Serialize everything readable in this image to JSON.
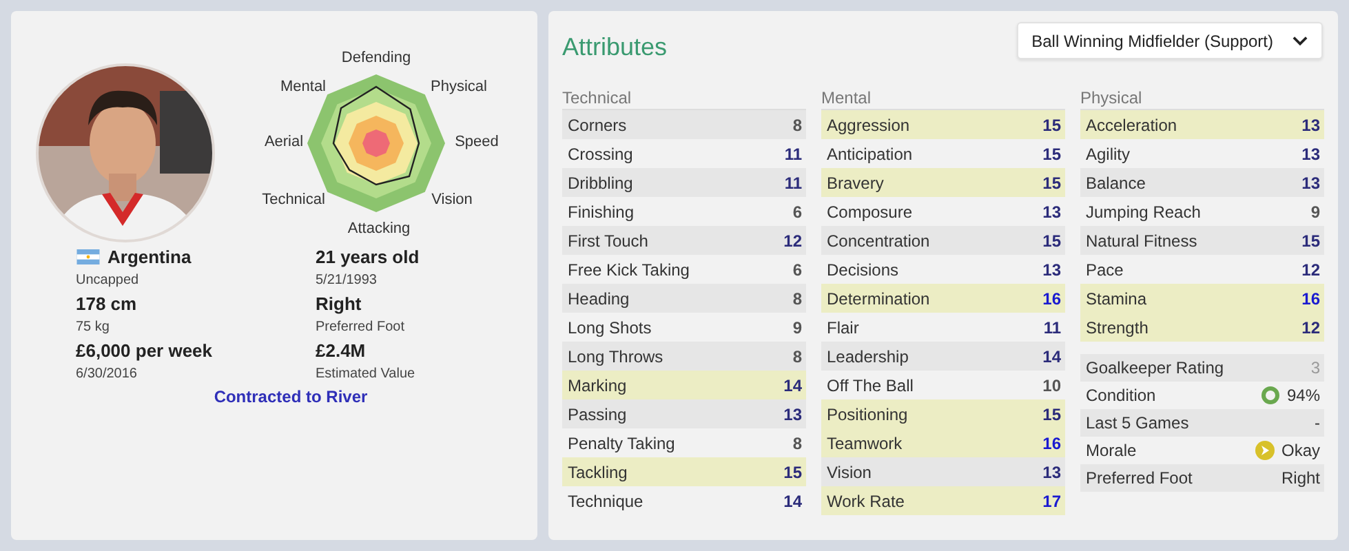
{
  "player": {
    "radar_labels": [
      {
        "text": "Defending"
      },
      {
        "text": "Mental"
      },
      {
        "text": "Physical"
      },
      {
        "text": "Aerial"
      },
      {
        "text": "Speed"
      },
      {
        "text": "Technical"
      },
      {
        "text": "Vision"
      },
      {
        "text": "Attacking"
      }
    ],
    "nationality": "Argentina",
    "caps": "Uncapped",
    "age": "21 years old",
    "birth_date": "5/21/1993",
    "height": "178 cm",
    "weight": "75 kg",
    "foot": "Right",
    "foot_label": "Preferred Foot",
    "wage": "£6,000 per week",
    "contract_end": "6/30/2016",
    "value": "£2.4M",
    "value_label": "Estimated Value",
    "contract_link": "Contracted to River"
  },
  "attributes": {
    "title": "Attributes",
    "role_dropdown": "Ball Winning Midfielder (Support)",
    "groups": [
      {
        "title": "Technical",
        "rows": [
          {
            "name": "Corners",
            "value": "8",
            "highlighted": false,
            "color": "#555555"
          },
          {
            "name": "Crossing",
            "value": "11",
            "highlighted": false,
            "color": "#2b2b7a"
          },
          {
            "name": "Dribbling",
            "value": "11",
            "highlighted": false,
            "color": "#2b2b7a"
          },
          {
            "name": "Finishing",
            "value": "6",
            "highlighted": false,
            "color": "#555555"
          },
          {
            "name": "First Touch",
            "value": "12",
            "highlighted": false,
            "color": "#2b2b7a"
          },
          {
            "name": "Free Kick Taking",
            "value": "6",
            "highlighted": false,
            "color": "#555555"
          },
          {
            "name": "Heading",
            "value": "8",
            "highlighted": false,
            "color": "#555555"
          },
          {
            "name": "Long Shots",
            "value": "9",
            "highlighted": false,
            "color": "#555555"
          },
          {
            "name": "Long Throws",
            "value": "8",
            "highlighted": false,
            "color": "#555555"
          },
          {
            "name": "Marking",
            "value": "14",
            "highlighted": true,
            "color": "#2b2b7a"
          },
          {
            "name": "Passing",
            "value": "13",
            "highlighted": false,
            "color": "#2b2b7a"
          },
          {
            "name": "Penalty Taking",
            "value": "8",
            "highlighted": false,
            "color": "#555555"
          },
          {
            "name": "Tackling",
            "value": "15",
            "highlighted": true,
            "color": "#2b2b7a"
          },
          {
            "name": "Technique",
            "value": "14",
            "highlighted": false,
            "color": "#2b2b7a"
          }
        ]
      },
      {
        "title": "Mental",
        "rows": [
          {
            "name": "Aggression",
            "value": "15",
            "highlighted": true,
            "color": "#2b2b7a"
          },
          {
            "name": "Anticipation",
            "value": "15",
            "highlighted": false,
            "color": "#2b2b7a"
          },
          {
            "name": "Bravery",
            "value": "15",
            "highlighted": true,
            "color": "#2b2b7a"
          },
          {
            "name": "Composure",
            "value": "13",
            "highlighted": false,
            "color": "#2b2b7a"
          },
          {
            "name": "Concentration",
            "value": "15",
            "highlighted": false,
            "color": "#2b2b7a"
          },
          {
            "name": "Decisions",
            "value": "13",
            "highlighted": false,
            "color": "#2b2b7a"
          },
          {
            "name": "Determination",
            "value": "16",
            "highlighted": true,
            "color": "#1a1ad0"
          },
          {
            "name": "Flair",
            "value": "11",
            "highlighted": false,
            "color": "#2b2b7a"
          },
          {
            "name": "Leadership",
            "value": "14",
            "highlighted": false,
            "color": "#2b2b7a"
          },
          {
            "name": "Off The Ball",
            "value": "10",
            "highlighted": false,
            "color": "#555555"
          },
          {
            "name": "Positioning",
            "value": "15",
            "highlighted": true,
            "color": "#2b2b7a"
          },
          {
            "name": "Teamwork",
            "value": "16",
            "highlighted": true,
            "color": "#1a1ad0"
          },
          {
            "name": "Vision",
            "value": "13",
            "highlighted": false,
            "color": "#2b2b7a"
          },
          {
            "name": "Work Rate",
            "value": "17",
            "highlighted": true,
            "color": "#1a1ad0"
          }
        ]
      },
      {
        "title": "Physical",
        "rows": [
          {
            "name": "Acceleration",
            "value": "13",
            "highlighted": true,
            "color": "#2b2b7a"
          },
          {
            "name": "Agility",
            "value": "13",
            "highlighted": false,
            "color": "#2b2b7a"
          },
          {
            "name": "Balance",
            "value": "13",
            "highlighted": false,
            "color": "#2b2b7a"
          },
          {
            "name": "Jumping Reach",
            "value": "9",
            "highlighted": false,
            "color": "#555555"
          },
          {
            "name": "Natural Fitness",
            "value": "15",
            "highlighted": false,
            "color": "#2b2b7a"
          },
          {
            "name": "Pace",
            "value": "12",
            "highlighted": false,
            "color": "#2b2b7a"
          },
          {
            "name": "Stamina",
            "value": "16",
            "highlighted": true,
            "color": "#1a1ad0"
          },
          {
            "name": "Strength",
            "value": "12",
            "highlighted": true,
            "color": "#2b2b7a"
          }
        ]
      }
    ],
    "summary": [
      {
        "label": "Goalkeeper Rating",
        "value": "3",
        "kind": "dim"
      },
      {
        "label": "Condition",
        "value": "94%",
        "kind": "condition"
      },
      {
        "label": "Last 5 Games",
        "value": "-",
        "kind": "plain"
      },
      {
        "label": "Morale",
        "value": "Okay",
        "kind": "morale"
      },
      {
        "label": "Preferred Foot",
        "value": "Right",
        "kind": "plain"
      }
    ]
  }
}
